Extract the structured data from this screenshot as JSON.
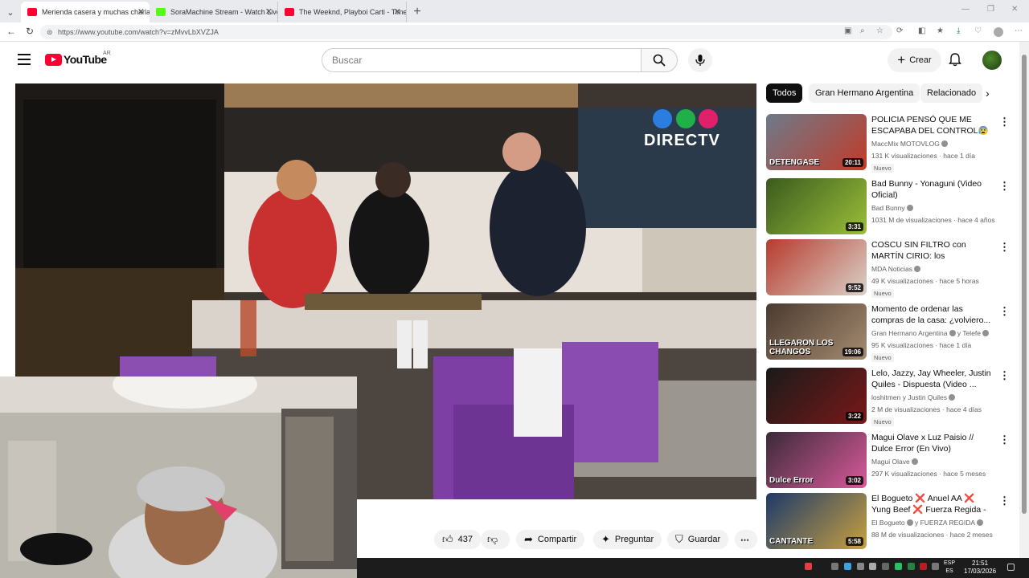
{
  "browser": {
    "tabs": [
      {
        "title": "Merienda casera y muchas charlas",
        "active": true,
        "favicon_color": "#ff0033"
      },
      {
        "title": "SoraMachine Stream - Watch Live",
        "active": false,
        "favicon_color": "#53fc18"
      },
      {
        "title": "The Weeknd, Playboi Carti - Timele",
        "active": false,
        "favicon_color": "#ff0033"
      }
    ],
    "new_tab": "+",
    "url": "https://www.youtube.com/watch?v=zMvvLbXVZJA"
  },
  "youtube": {
    "logo_text": "YouTube",
    "region": "AR",
    "search_placeholder": "Buscar",
    "create_label": "Crear"
  },
  "actions": {
    "like_count": "437",
    "share_label": "Compartir",
    "ask_label": "Preguntar",
    "save_label": "Guardar"
  },
  "video": {
    "watermark": "DIRECTV"
  },
  "chips": [
    {
      "label": "Todos",
      "active": true
    },
    {
      "label": "Gran Hermano Argentina",
      "active": false
    },
    {
      "label": "Relacionado",
      "active": false
    }
  ],
  "recommendations": [
    {
      "title": "POLICIA PENSÓ QUE ME ESCAPABA DEL CONTROL😰 ...",
      "channel": "MaccMix MOTOVLOG",
      "verified": true,
      "meta": "131 K visualizaciones · hace 1 día",
      "badge": "Nuevo",
      "duration": "20:11",
      "thumb_text": "DETENGASE",
      "thumb_colors": [
        "#6e7a8a",
        "#c23b2a"
      ]
    },
    {
      "title": "Bad Bunny - Yonaguni (Video Oficial)",
      "channel": "Bad Bunny",
      "verified": true,
      "meta": "1031 M de visualizaciones · hace 4 años",
      "badge": "",
      "duration": "3:31",
      "thumb_text": "",
      "thumb_colors": [
        "#3a5a1e",
        "#9bbf3a"
      ]
    },
    {
      "title": "COSCU SIN FILTRO con MARTÍN CIRIO: los POLÉMICOS CA ...",
      "channel": "MDA Noticias",
      "verified": true,
      "meta": "49 K visualizaciones · hace 5 horas",
      "badge": "Nuevo",
      "duration": "9:52",
      "thumb_text": "",
      "thumb_colors": [
        "#b83a2e",
        "#d9d2c8"
      ]
    },
    {
      "title": "Momento de ordenar las compras de la casa: ¿volviero...",
      "channel": "Gran Hermano Argentina",
      "verified": true,
      "channel_extra": "y Telefe",
      "meta": "95 K visualizaciones · hace 1 día",
      "badge": "Nuevo",
      "duration": "19:06",
      "thumb_text": "LLEGARON LOS CHANGOS",
      "thumb_colors": [
        "#4a3a30",
        "#a58b70"
      ]
    },
    {
      "title": "Lelo, Jazzy, Jay Wheeler, Justin Quiles - Dispuesta (Video ...",
      "channel": "loshitmen y Justin Quiles",
      "verified": true,
      "meta": "2 M de visualizaciones · hace 4 días",
      "badge": "Nuevo",
      "duration": "3:22",
      "thumb_text": "",
      "thumb_colors": [
        "#1a1a1a",
        "#7a1818"
      ]
    },
    {
      "title": "Magui Olave x  Luz Paisio // Dulce Error (En Vivo)",
      "channel": "Magui Olave",
      "verified": true,
      "meta": "297 K visualizaciones · hace 5 meses",
      "badge": "",
      "duration": "3:02",
      "thumb_text": "Dulce Error",
      "thumb_colors": [
        "#3a2a38",
        "#d85a9a"
      ]
    },
    {
      "title": "El Bogueto ❌ Anuel AA ❌ Yung Beef ❌ Fuerza Regida - ...",
      "channel": "El Bogueto",
      "verified": true,
      "channel_extra": "y FUERZA REGIDA",
      "meta": "88 M de visualizaciones · hace 2 meses",
      "badge": "",
      "duration": "5:58",
      "thumb_text": "CANTANTE",
      "thumb_colors": [
        "#1d3a6a",
        "#c8a040"
      ]
    }
  ],
  "taskbar": {
    "lang_top": "ESP",
    "lang_bottom": "ES",
    "time": "21:51",
    "date": "17/03/2026"
  }
}
